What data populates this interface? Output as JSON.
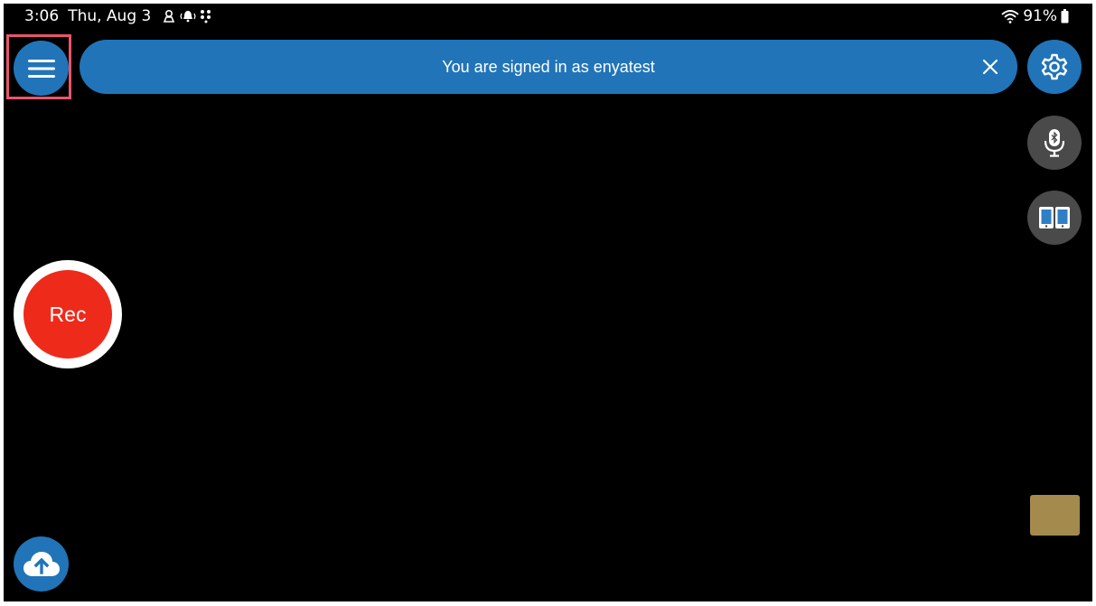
{
  "status_bar": {
    "time": "3:06",
    "date": "Thu, Aug 3",
    "battery": "91%",
    "icons": [
      "location-person-icon",
      "vibrate-bell-icon",
      "dots-icon",
      "wifi-icon",
      "battery-icon"
    ]
  },
  "banner": {
    "message": "You are signed in as enyatest"
  },
  "record": {
    "label": "Rec"
  },
  "colors": {
    "primary_blue": "#2174b8",
    "record_red": "#ee2a1b",
    "secondary_gray": "#4a4a4a",
    "thumbnail": "#a48b4d",
    "highlight": "#e8566b"
  }
}
